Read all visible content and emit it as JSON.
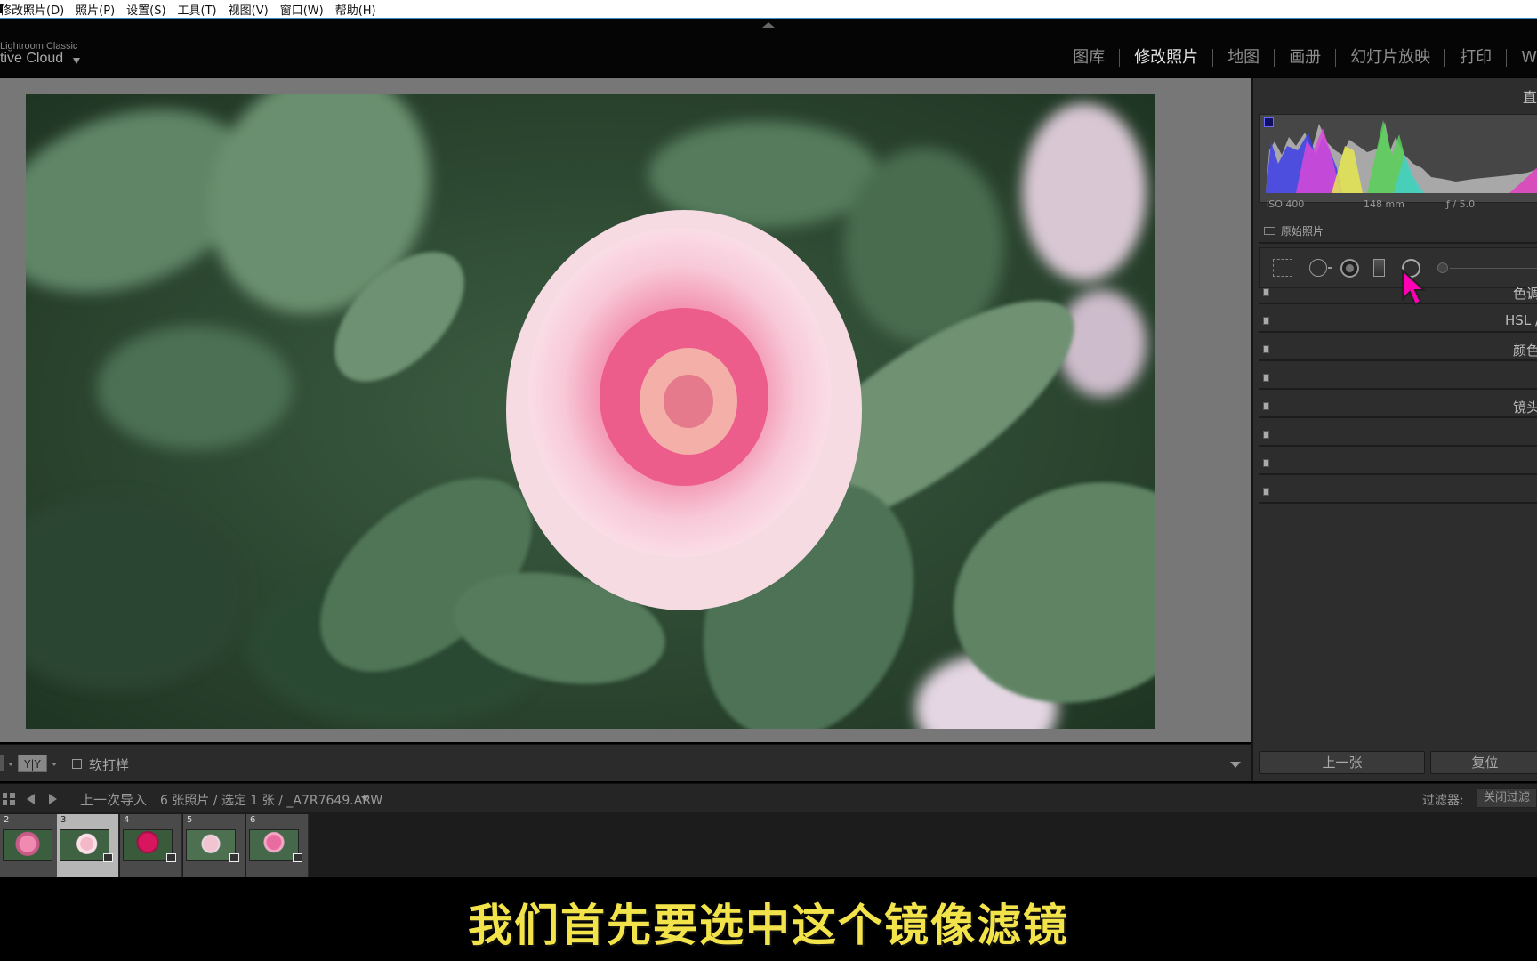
{
  "menu": {
    "items": [
      "修改照片(D)",
      "照片(P)",
      "设置(S)",
      "工具(T)",
      "视图(V)",
      "窗口(W)",
      "帮助(H)"
    ]
  },
  "identity": {
    "product": "Lightroom Classic",
    "account": "tive Cloud"
  },
  "modules": {
    "items": [
      "图库",
      "修改照片",
      "地图",
      "画册",
      "幻灯片放映",
      "打印",
      "W"
    ],
    "active_index": 1
  },
  "toolbar": {
    "softproof_label": "软打样",
    "yy_label": "Y|Y"
  },
  "histogram": {
    "panel_title": "直",
    "iso": "ISO 400",
    "focal": "148 mm",
    "aperture": "ƒ / 5.0",
    "original_label": "原始照片"
  },
  "panels": {
    "sections": [
      "色调",
      "HSL /",
      "颜色",
      "",
      "镜头",
      "",
      "",
      ""
    ]
  },
  "buttons": {
    "previous": "上一张",
    "reset": "复位"
  },
  "filmstrip_bar": {
    "source": "上一次导入",
    "count": "6 张照片 / 选定 1 张 / _A7R7649.ARW",
    "filter_label": "过滤器:",
    "filter_value": "关闭过滤"
  },
  "filmstrip": {
    "thumbs": [
      {
        "num": "2",
        "selected": false
      },
      {
        "num": "3",
        "selected": true
      },
      {
        "num": "4",
        "selected": false
      },
      {
        "num": "5",
        "selected": false
      },
      {
        "num": "6",
        "selected": false
      }
    ]
  },
  "subtitle": "我们首先要选中这个镜像滤镜",
  "colors": {
    "subtitle": "#f3e34a",
    "cursor": "#ff00b4"
  }
}
